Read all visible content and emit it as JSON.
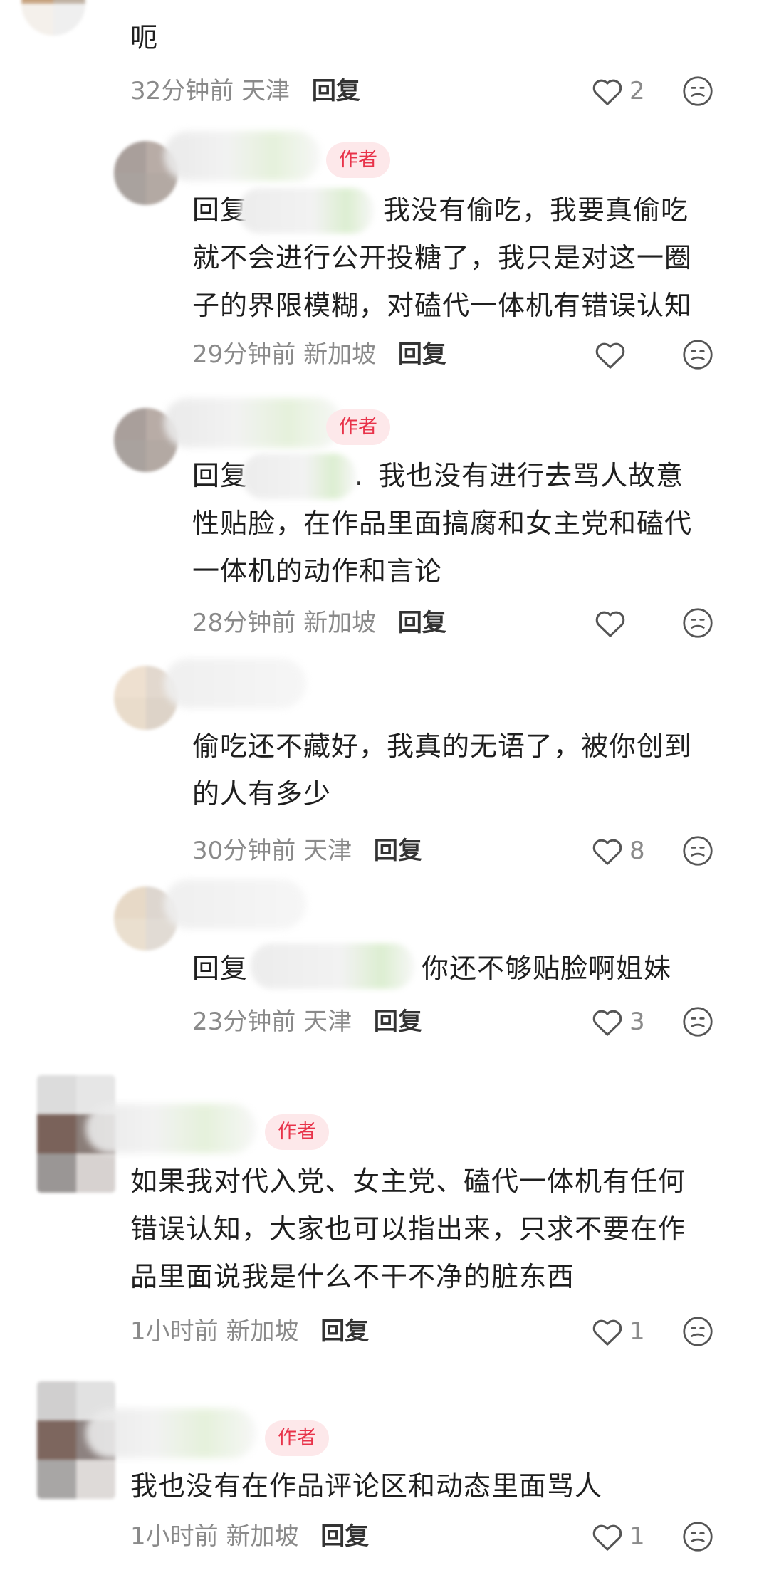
{
  "colors": {
    "author_badge_bg": "#fde8ea",
    "author_badge_text": "#e8334a",
    "meta_text": "#8a8a8a"
  },
  "icons": {
    "like": "heart-outline-icon",
    "dislike": "frown-face-icon"
  },
  "comments": [
    {
      "text": "呃",
      "time": "32分钟前",
      "location": "天津",
      "reply_label": "回复",
      "likes": "2"
    },
    {
      "author_badge": "作者",
      "reply_prefix": "回复",
      "text_lines": [
        "我没有偷吃，我要真偷吃",
        "就不会进行公开投糖了，我只是对这一圈",
        "子的界限模糊，对磕代一体机有错误认知"
      ],
      "time": "29分钟前",
      "location": "新加坡",
      "reply_label": "回复",
      "likes": ""
    },
    {
      "author_badge": "作者",
      "reply_prefix": "回复",
      "reply_target_tail": ".",
      "text_lines": "我也没有进行去骂人故意|性贴脸，在作品里面搞腐和女主党和磕代|一体机的动作和言论",
      "time": "28分钟前",
      "location": "新加坡",
      "reply_label": "回复",
      "likes": ""
    },
    {
      "text_lines": [
        "偷吃还不藏好，我真的无语了，被你创到",
        "的人有多少"
      ],
      "time": "30分钟前",
      "location": "天津",
      "reply_label": "回复",
      "likes": "8"
    },
    {
      "reply_prefix": "回复",
      "text": "你还不够贴脸啊姐妹",
      "time": "23分钟前",
      "location": "天津",
      "reply_label": "回复",
      "likes": "3"
    },
    {
      "author_badge": "作者",
      "text_lines": [
        "如果我对代入党、女主党、磕代一体机有任何",
        "错误认知，大家也可以指出来，只求不要在作",
        "品里面说我是什么不干不净的脏东西"
      ],
      "time": "1小时前",
      "location": "新加坡",
      "reply_label": "回复",
      "likes": "1"
    },
    {
      "author_badge": "作者",
      "text": "我也没有在作品评论区和动态里面骂人",
      "time": "1小时前",
      "location": "新加坡",
      "reply_label": "回复",
      "likes": "1"
    }
  ]
}
